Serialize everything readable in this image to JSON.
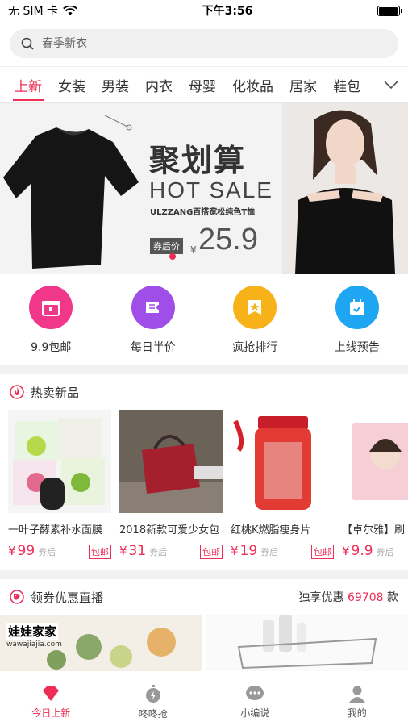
{
  "status": {
    "carrier": "无 SIM 卡",
    "time": "下午3:56",
    "battery_level": 0.9
  },
  "search": {
    "placeholder": "春季新衣"
  },
  "categories": [
    "上新",
    "女装",
    "男装",
    "内衣",
    "母婴",
    "化妆品",
    "居家",
    "鞋包"
  ],
  "banner": {
    "title": "聚划算",
    "subtitle": "HOT SALE",
    "desc": "ULZZANG百搭宽松纯色T恤",
    "price_tag": "券后价",
    "currency": "¥",
    "price": "25.9"
  },
  "quick": [
    {
      "label": "9.9包邮",
      "icon": "gift-box-icon",
      "color": "#f0378a"
    },
    {
      "label": "每日半价",
      "icon": "ticket-icon",
      "color": "#a04ee8"
    },
    {
      "label": "疯抢排行",
      "icon": "star-badge-icon",
      "color": "#f7b21a"
    },
    {
      "label": "上线预告",
      "icon": "calendar-icon",
      "color": "#1fa6f2"
    }
  ],
  "hot": {
    "title": "热卖新品",
    "products": [
      {
        "name": "一叶子酵素补水面膜",
        "currency": "¥",
        "price": "99",
        "after": "券后",
        "tag": "包邮"
      },
      {
        "name": "2018新款可爱少女包",
        "currency": "¥",
        "price": "31",
        "after": "券后",
        "tag": "包邮"
      },
      {
        "name": "红桃K燃脂瘦身片",
        "currency": "¥",
        "price": "19",
        "after": "券后",
        "tag": "包邮"
      },
      {
        "name": "【卓尔雅】刷",
        "currency": "¥",
        "price": "9.9",
        "after": "券后",
        "tag": ""
      }
    ]
  },
  "coupon": {
    "title": "领券优惠直播",
    "right_prefix": "独享优惠",
    "right_count": "69708",
    "right_suffix": "款",
    "brand_logo_text": "娃娃家家",
    "brand_url": "wawajiajia.com"
  },
  "tabs": [
    {
      "label": "今日上新",
      "icon": "heart-diamond-icon"
    },
    {
      "label": "咚咚抢",
      "icon": "stopwatch-icon"
    },
    {
      "label": "小编说",
      "icon": "chat-bubble-icon"
    },
    {
      "label": "我的",
      "icon": "user-icon"
    }
  ],
  "colors": {
    "accent": "#ee2d55"
  }
}
